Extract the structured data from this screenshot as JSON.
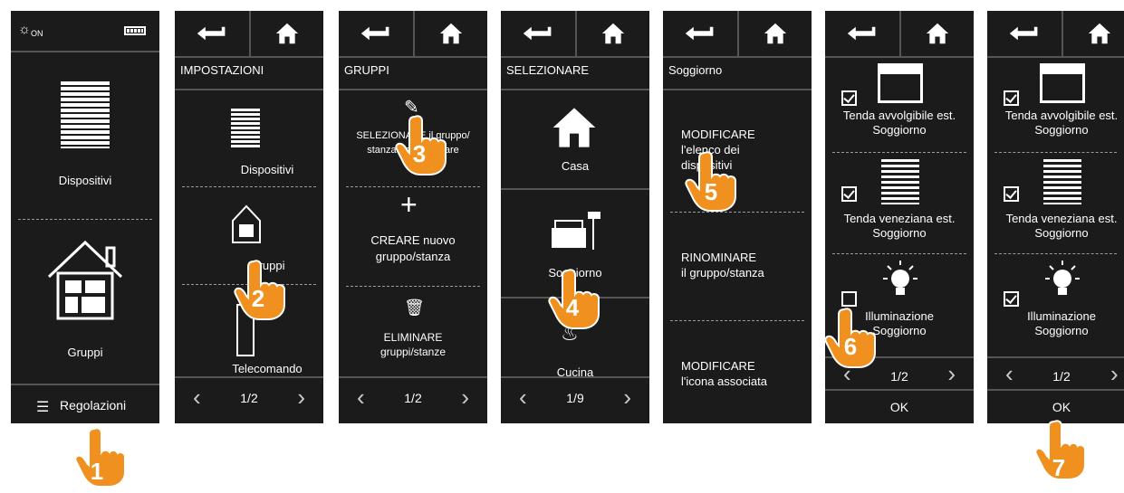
{
  "panel1": {
    "status_icon": "sun-on-icon",
    "status_text": "ON",
    "battery": "battery-icon",
    "devices_label": "Dispositivi",
    "groups_label": "Gruppi",
    "settings_label": "Regolazioni",
    "step": "1"
  },
  "panel2": {
    "header": "IMPOSTAZIONI",
    "items": [
      "Dispositivi",
      "Gruppi",
      "Telecomando"
    ],
    "page": "1/2",
    "step": "2"
  },
  "panel3": {
    "header": "GRUPPI",
    "items": [
      {
        "line1": "SELEZIONARE il gruppo/",
        "line2": "stanza da modificare"
      },
      {
        "line1": "CREARE nuovo",
        "line2": "gruppo/stanza"
      },
      {
        "line1": "ELIMINARE",
        "line2": "gruppi/stanze"
      }
    ],
    "page": "1/2",
    "step": "3"
  },
  "panel4": {
    "header": "SELEZIONARE",
    "items": [
      "Casa",
      "Soggiorno",
      "Cucina"
    ],
    "page": "1/9",
    "step": "4"
  },
  "panel5": {
    "header": "Soggiorno",
    "items": [
      {
        "line1": "MODIFICARE",
        "line2": "l'elenco dei",
        "line3": "dispositivi"
      },
      {
        "line1": "RINOMINARE",
        "line2": "il gruppo/stanza",
        "line3": ""
      },
      {
        "line1": "MODIFICARE",
        "line2": "l'icona associata",
        "line3": ""
      }
    ],
    "step": "5"
  },
  "panel6": {
    "items": [
      {
        "line1": "Tenda avvolgibile est.",
        "line2": "Soggiorno",
        "checked": true
      },
      {
        "line1": "Tenda veneziana est.",
        "line2": "Soggiorno",
        "checked": true
      },
      {
        "line1": "Illuminazione",
        "line2": "Soggiorno",
        "checked": false
      }
    ],
    "page": "1/2",
    "ok": "OK",
    "step": "6"
  },
  "panel7": {
    "items": [
      {
        "line1": "Tenda avvolgibile est.",
        "line2": "Soggiorno",
        "checked": true
      },
      {
        "line1": "Tenda veneziana est.",
        "line2": "Soggiorno",
        "checked": true
      },
      {
        "line1": "Illuminazione",
        "line2": "Soggiorno",
        "checked": true
      }
    ],
    "page": "1/2",
    "ok": "OK",
    "step": "7"
  },
  "colors": {
    "screen_bg": "#1b1b1b",
    "hand": "#f0901e",
    "separator": "#555555"
  }
}
